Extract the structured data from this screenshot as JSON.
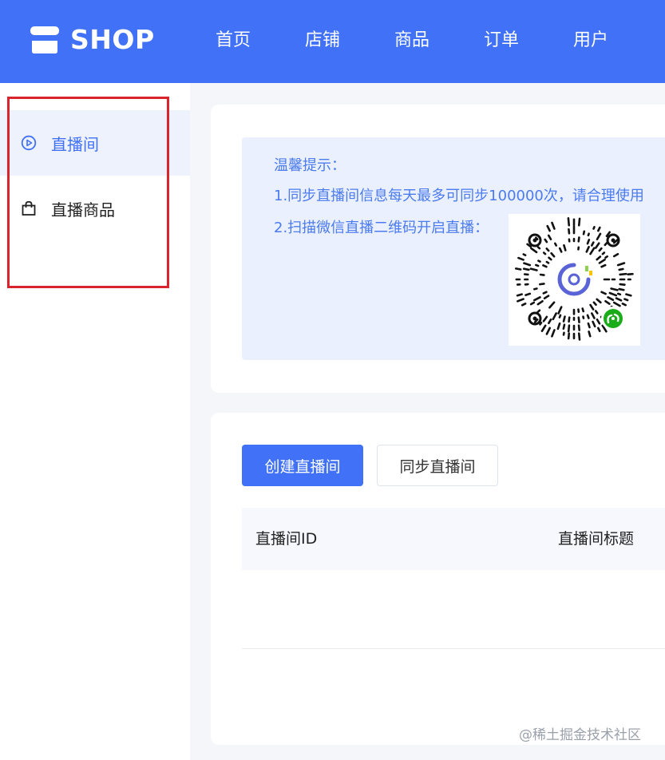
{
  "header": {
    "logo_text": "SHOP",
    "nav": [
      "首页",
      "店铺",
      "商品",
      "订单",
      "用户"
    ],
    "colors": {
      "bar": "#4071f6",
      "text": "#ffffff"
    }
  },
  "sidebar": {
    "items": [
      {
        "label": "直播间",
        "icon": "play-circle-icon",
        "active": true
      },
      {
        "label": "直播商品",
        "icon": "shopping-bag-icon",
        "active": false
      }
    ],
    "highlight_color": "#d9232d"
  },
  "tips": {
    "title": "温馨提示：",
    "line1": "1.同步直播间信息每天最多可同步100000次，请合理使用",
    "line2": "2.扫描微信直播二维码开启直播：",
    "qr_icon": "wechat-miniprogram-qr-code"
  },
  "actions": {
    "create_label": "创建直播间",
    "sync_label": "同步直播间"
  },
  "table": {
    "columns": [
      "直播间ID",
      "直播间标题"
    ]
  },
  "watermark": "@稀土掘金技术社区"
}
